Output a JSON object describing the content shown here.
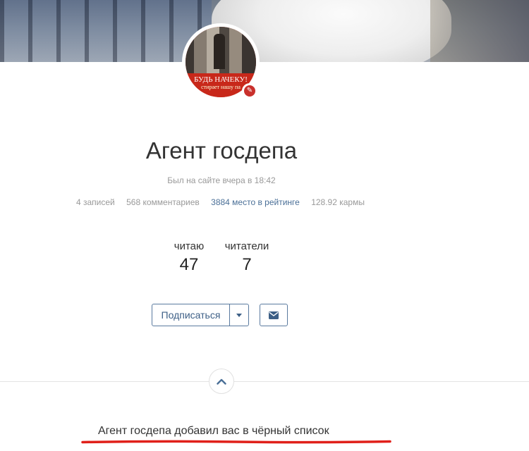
{
  "profile": {
    "name": "Агент госдепа",
    "last_seen": "Был на сайте вчера в 18:42",
    "avatar": {
      "banner_text": "БУДЬ НАЧЕКУ!",
      "banner_subtext": "стирает нашу па"
    }
  },
  "stats": {
    "posts": "4 записей",
    "comments": "568 комментариев",
    "rating": "3884 место в рейтинге",
    "karma": "128.92 кармы"
  },
  "follow": {
    "reading_label": "читаю",
    "reading_count": "47",
    "readers_label": "читатели",
    "readers_count": "7"
  },
  "actions": {
    "subscribe_label": "Подписаться"
  },
  "notice": {
    "text": "Агент госдепа добавил вас в чёрный список"
  },
  "colors": {
    "accent": "#3d5f86",
    "link": "#4a6f97",
    "underline": "#e0201a",
    "edit_badge": "#c9302c"
  },
  "icons": [
    "pencil-icon",
    "caret-down-icon",
    "envelope-icon",
    "chevron-up-icon"
  ]
}
